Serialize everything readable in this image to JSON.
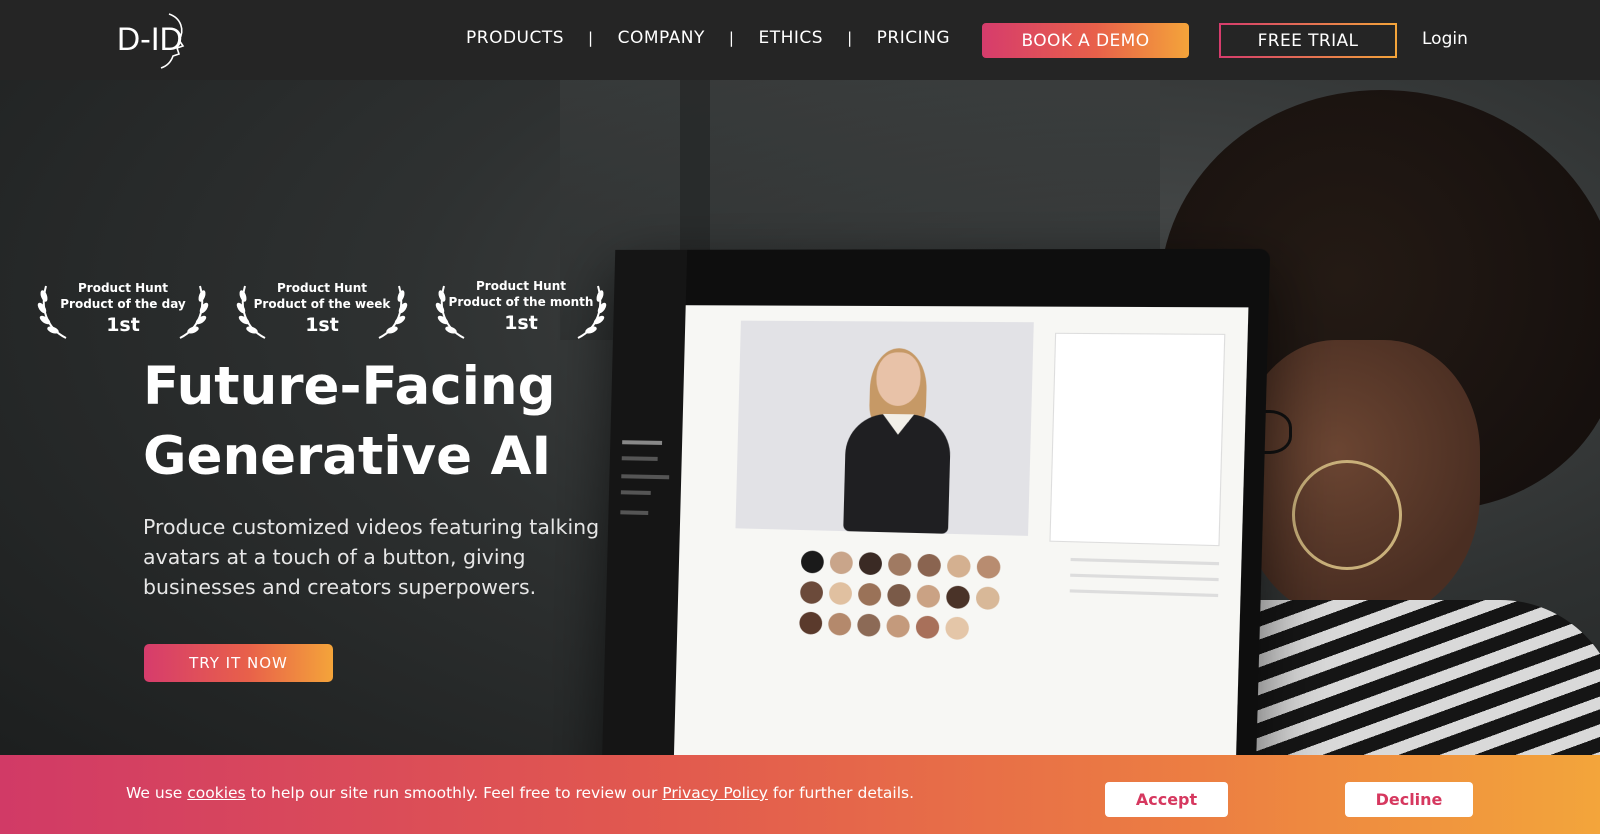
{
  "nav": {
    "logo_text": "D-ID",
    "links": [
      {
        "label": "PRODUCTS"
      },
      {
        "label": "COMPANY"
      },
      {
        "label": "ETHICS"
      },
      {
        "label": "PRICING"
      }
    ],
    "separator": "|",
    "book_demo": "BOOK A DEMO",
    "free_trial": "FREE TRIAL",
    "login": "Login"
  },
  "awards": [
    {
      "line1": "Product Hunt",
      "line2": "Product of the day",
      "rank": "1st"
    },
    {
      "line1": "Product Hunt",
      "line2": "Product of the week",
      "rank": "1st"
    },
    {
      "line1": "Product Hunt",
      "line2": "Product of the month",
      "rank": "1st"
    }
  ],
  "hero": {
    "title_line1": "Future-Facing",
    "title_line2": "Generative AI",
    "subtitle": "Produce customized videos featuring talking avatars at a touch of a button, giving businesses and creators superpowers.",
    "cta": "TRY IT NOW"
  },
  "cookie": {
    "text_before": "We use ",
    "cookies_link": "cookies",
    "text_middle": " to help our site run smoothly. Feel free to review our ",
    "privacy_link": "Privacy Policy",
    "text_after": " for further details.",
    "accept": "Accept",
    "decline": "Decline"
  },
  "colors": {
    "nav_bg": "#252525",
    "accent_start": "#d63c6c",
    "accent_end": "#f4a43a",
    "cookie_button_text": "#d6385f"
  }
}
